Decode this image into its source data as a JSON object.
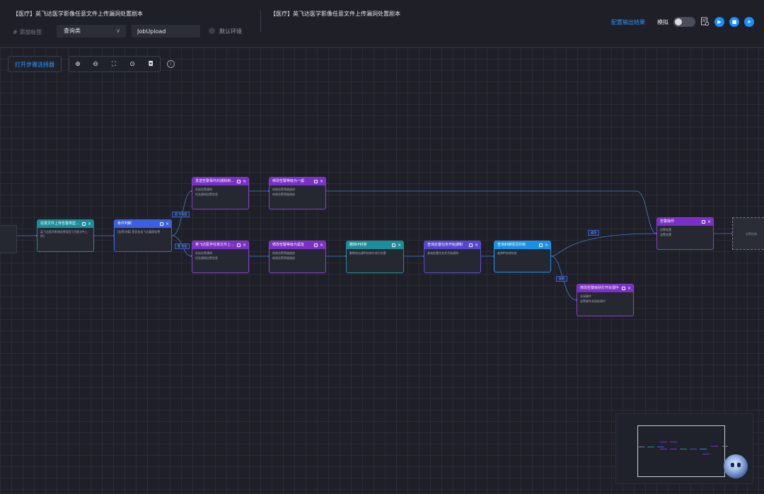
{
  "header": {
    "title_left": "【医疗】英飞达医学影像任意文件上传漏洞处置剧本",
    "title_right": "【医疗】英飞达医学影像任意文件上传漏洞处置剧本",
    "add_tag": "# 添加标签",
    "category_select": "查询类",
    "job_input": "JobUpload",
    "environment": "默认环境",
    "config_output": "配置输出结果",
    "simulate_label": "模拟"
  },
  "toolbar": {
    "open_step_picker": "打开步骤选择器",
    "icons": [
      "zoom-in-icon",
      "zoom-out-icon",
      "fit-view-icon",
      "focus-icon",
      "camera-icon"
    ]
  },
  "nodes": {
    "n1": {
      "title": "任意文件上传告警类型...",
      "l1": "英飞达医学影像告警类型 [任意文件上传]"
    },
    "n2": {
      "title": "条件判断",
      "l1": "[告警详情] 是否包含飞达漏洞告警"
    },
    "n3": {
      "title": "发送告警事件的通知到...",
      "l1": "发送告警通知",
      "l2": "任务通知告警信息"
    },
    "n4": {
      "title": "修改告警等级为一般",
      "l1": "修改告警等级描述",
      "l2": "修改告警等级描述"
    },
    "n5": {
      "title": "英飞达医学任意文件上...",
      "l1": "发送告警通知",
      "l2": "任务通知告警信息"
    },
    "n6": {
      "title": "修改告警等级为紧急",
      "l1": "修改告警等级描述",
      "l2": "修改告警等级描述"
    },
    "n7": {
      "title": "删除IP封禁",
      "l1": "删除攻击源IP封禁并进行处置"
    },
    "n8": {
      "title": "查询处置任务开始通知",
      "l1": "查询处置任务并开始通知"
    },
    "n9": {
      "title": "查询封禁情况并核",
      "l1": "查询IP封禁状态"
    },
    "n10": {
      "title": "告警操作",
      "l1": "告警处置",
      "l2": "告警处置"
    },
    "n11": {
      "title": "修改告警级别打开处理中",
      "l1": "关闭事件",
      "l2": "告警事件关闭处理中"
    },
    "n12": {
      "title": "",
      "l1": "告警结束"
    }
  },
  "edge_labels": {
    "branch_no": "否 不包含",
    "branch_yes": "是 包含",
    "branch_success": "成功",
    "branch_fail": "失败"
  },
  "colors": {
    "purple": "#7a2fc7",
    "teal": "#1c8d9a",
    "blue": "#3b5fe0",
    "indigo": "#5545d0",
    "sky": "#1a8fe8",
    "accent": "#2f95ff"
  }
}
